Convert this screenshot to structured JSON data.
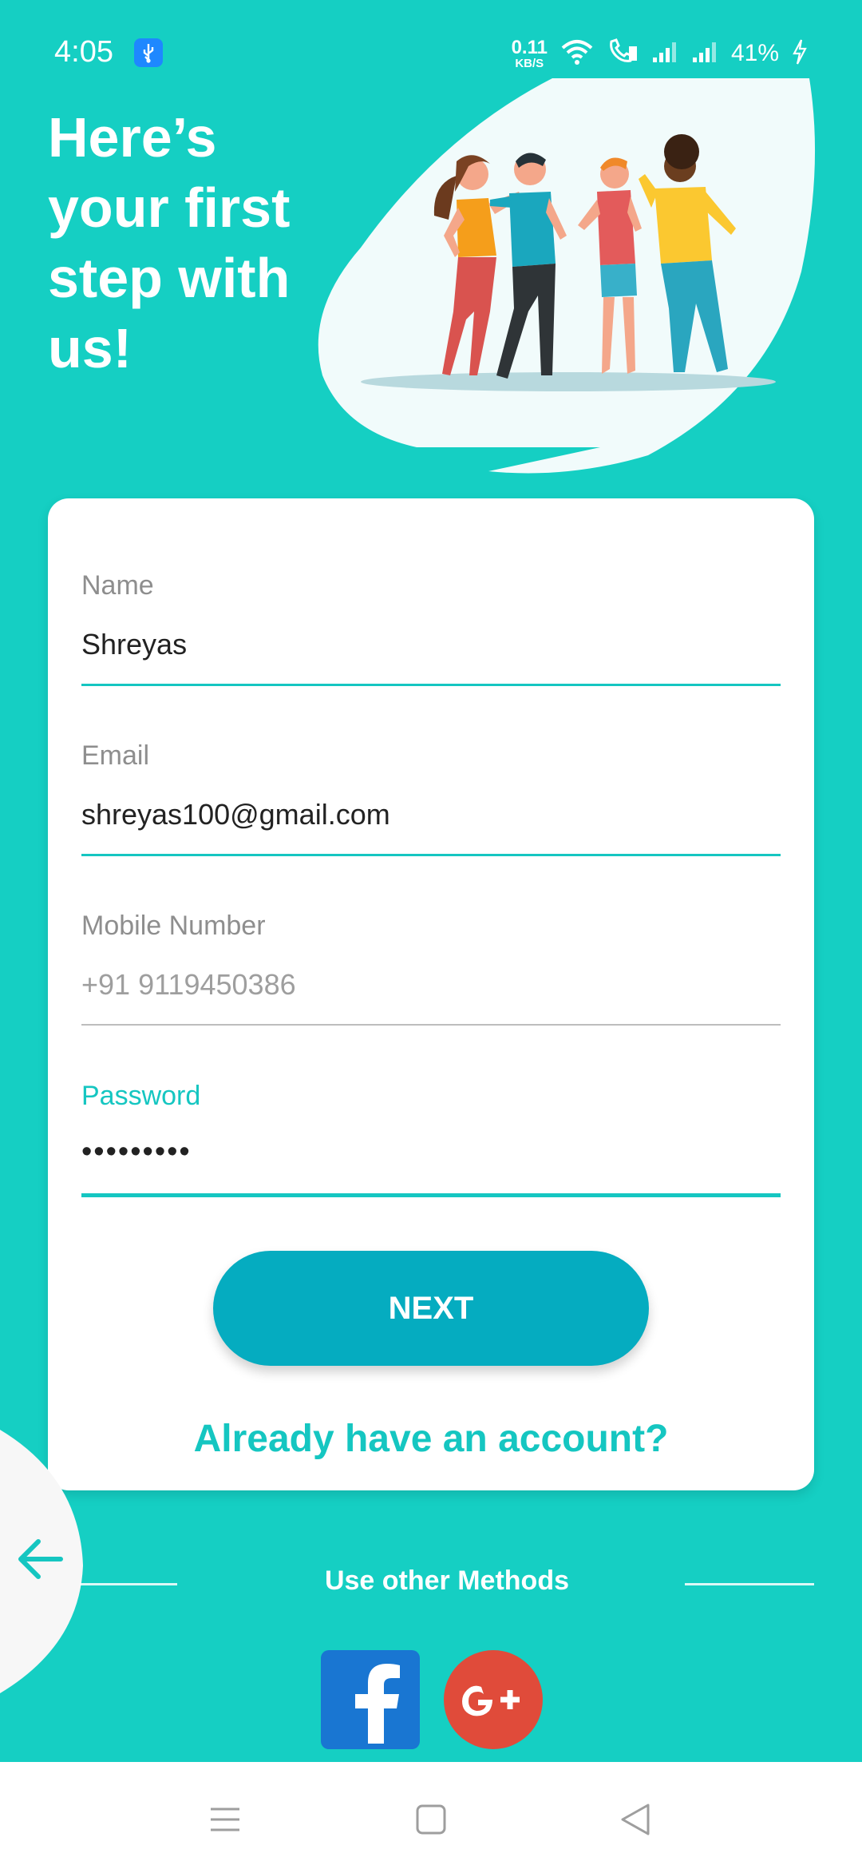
{
  "status_bar": {
    "time": "4:05",
    "net_speed_value": "0.11",
    "net_speed_unit": "KB/S",
    "battery": "41%"
  },
  "header": {
    "title_lines": [
      "Here’s",
      "your first",
      "step with",
      "us!"
    ]
  },
  "form": {
    "name_label": "Name",
    "name_value": "Shreyas",
    "email_label": "Email",
    "email_value": "shreyas100@gmail.com",
    "mobile_label": "Mobile Number",
    "mobile_placeholder": "+91 9119450386",
    "password_label": "Password",
    "password_value": "•••••••••",
    "next_label": "NEXT",
    "signin_link": "Already have an account?"
  },
  "other_methods": {
    "label": "Use other Methods",
    "providers": [
      "facebook",
      "google-plus"
    ]
  },
  "icons": {
    "back": "arrow-left-icon",
    "usb": "usb-icon",
    "wifi": "wifi-icon",
    "call": "call-icon",
    "signal": "signal-icon",
    "charging": "charging-icon"
  },
  "colors": {
    "background": "#15CFC3",
    "accent": "#15C6C1",
    "button": "#05ACC0",
    "facebook": "#1976D2",
    "google_plus": "#E04B3A"
  }
}
